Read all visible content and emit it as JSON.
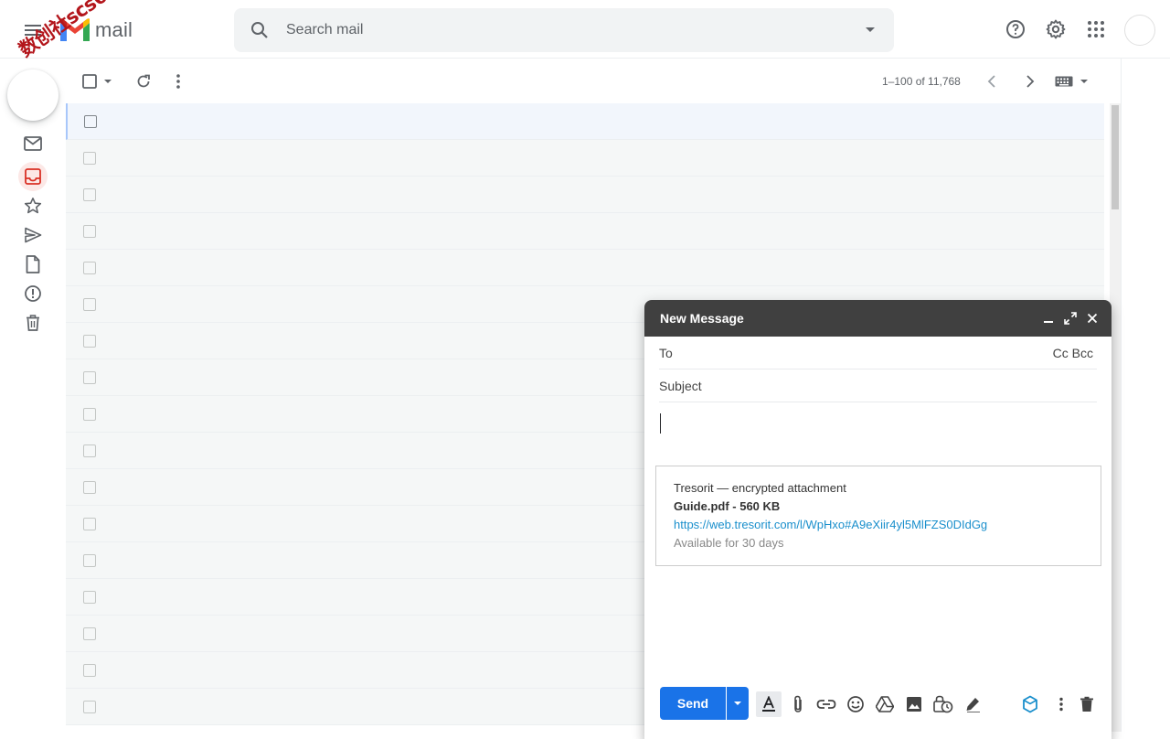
{
  "header": {
    "logo_text": "mail",
    "watermark": "数创社scs66",
    "search": {
      "placeholder": "Search mail"
    }
  },
  "toolbar": {
    "pagination": "1–100 of 11,768"
  },
  "list": {
    "row_count": 17
  },
  "compose": {
    "title": "New Message",
    "to_label": "To",
    "cc_bcc_label": "Cc Bcc",
    "subject_placeholder": "Subject",
    "attachment": {
      "provider": "Tresorit — encrypted attachment",
      "file": "Guide.pdf - 560 KB",
      "link": "https://web.tresorit.com/l/WpHxo#A9eXiir4yl5MlFZS0DIdGg",
      "availability": "Available for 30 days"
    },
    "send_label": "Send"
  },
  "colors": {
    "accent_blue": "#1a73e8",
    "compose_header": "#404040",
    "link": "#1a8fcc",
    "active_rail_bg": "#fce8e6",
    "active_rail_icon": "#d93025"
  }
}
